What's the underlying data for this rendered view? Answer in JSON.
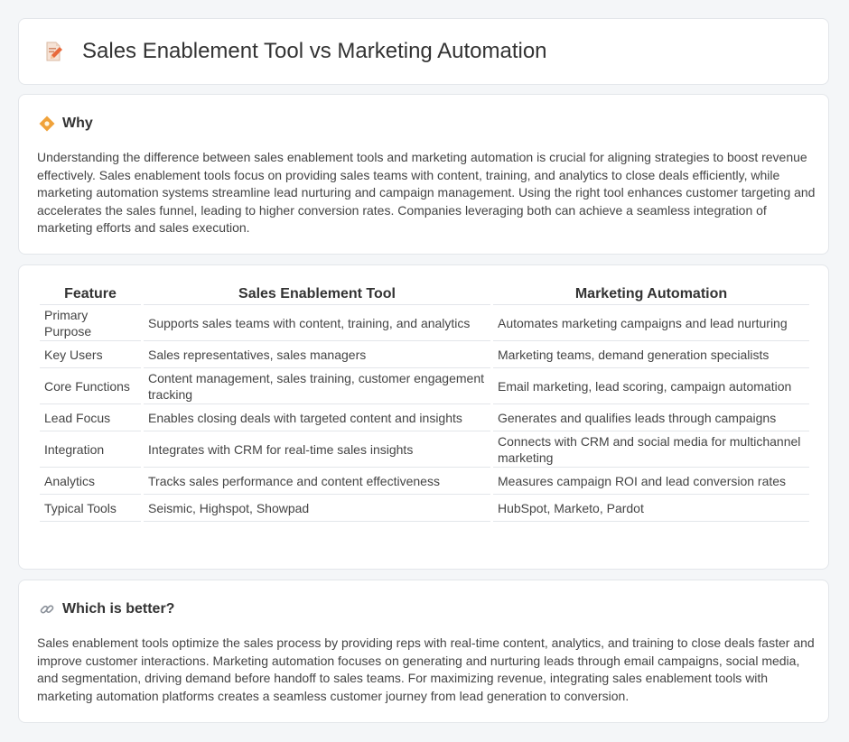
{
  "header": {
    "title": "Sales Enablement Tool vs Marketing Automation",
    "icon": "document-pencil-icon"
  },
  "why": {
    "icon": "diamond-icon",
    "title": "Why",
    "text": "Understanding the difference between sales enablement tools and marketing automation is crucial for aligning strategies to boost revenue effectively. Sales enablement tools focus on providing sales teams with content, training, and analytics to close deals efficiently, while marketing automation systems streamline lead nurturing and campaign management. Using the right tool enhances customer targeting and accelerates the sales funnel, leading to higher conversion rates. Companies leveraging both can achieve a seamless integration of marketing efforts and sales execution."
  },
  "table": {
    "headers": [
      "Feature",
      "Sales Enablement Tool",
      "Marketing Automation"
    ],
    "rows": [
      [
        "Primary Purpose",
        "Supports sales teams with content, training, and analytics",
        "Automates marketing campaigns and lead nurturing"
      ],
      [
        "Key Users",
        "Sales representatives, sales managers",
        "Marketing teams, demand generation specialists"
      ],
      [
        "Core Functions",
        "Content management, sales training, customer engagement tracking",
        "Email marketing, lead scoring, campaign automation"
      ],
      [
        "Lead Focus",
        "Enables closing deals with targeted content and insights",
        "Generates and qualifies leads through campaigns"
      ],
      [
        "Integration",
        "Integrates with CRM for real-time sales insights",
        "Connects with CRM and social media for multichannel marketing"
      ],
      [
        "Analytics",
        "Tracks sales performance and content effectiveness",
        "Measures campaign ROI and lead conversion rates"
      ],
      [
        "Typical Tools",
        "Seismic, Highspot, Showpad",
        "HubSpot, Marketo, Pardot"
      ]
    ]
  },
  "better": {
    "icon": "link-icon",
    "title": "Which is better?",
    "text": "Sales enablement tools optimize the sales process by providing reps with real-time content, analytics, and training to close deals faster and improve customer interactions. Marketing automation focuses on generating and nurturing leads through email campaigns, social media, and segmentation, driving demand before handoff to sales teams. For maximizing revenue, integrating sales enablement tools with marketing automation platforms creates a seamless customer journey from lead generation to conversion."
  },
  "colors": {
    "background": "#f4f6f8",
    "card": "#ffffff",
    "border": "#e3e6ea",
    "accent_orange": "#f0a23a"
  }
}
